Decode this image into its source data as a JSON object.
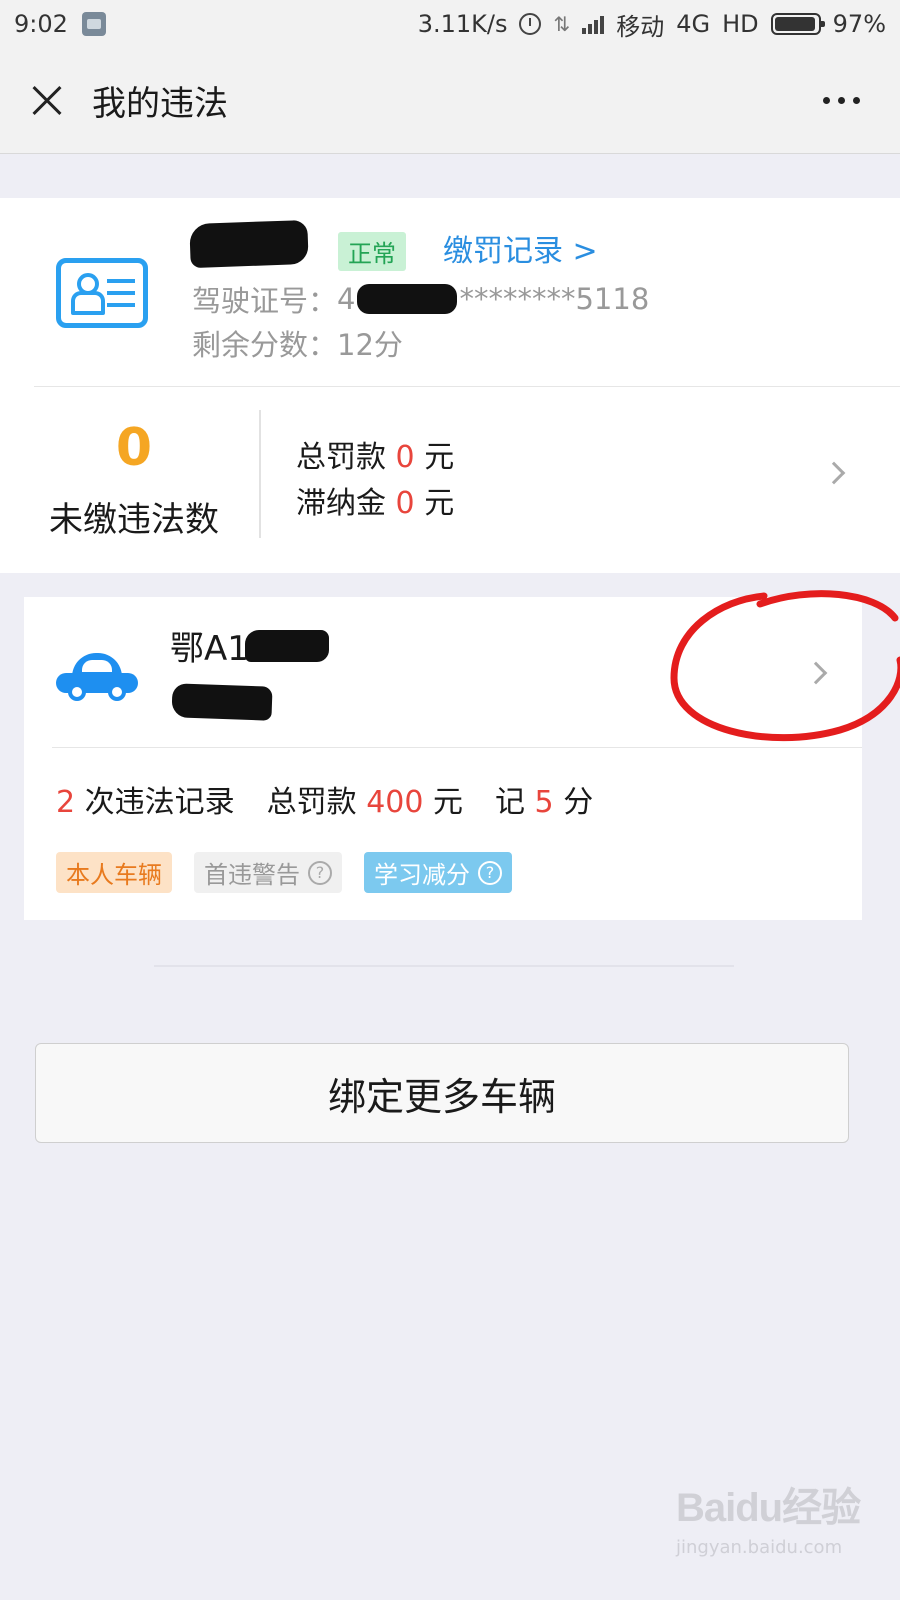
{
  "status_bar": {
    "time": "9:02",
    "net_speed": "3.11K/s",
    "carrier": "移动",
    "network": "4G",
    "hd": "HD",
    "battery": "97%"
  },
  "nav": {
    "title": "我的违法"
  },
  "license": {
    "status_tag": "正常",
    "pay_record_link": "缴罚记录 >",
    "license_no_label": "驾驶证号：",
    "license_no_prefix": "4",
    "license_no_suffix": "********5118",
    "points_left": "剩余分数：12分",
    "unpaid_count": "0",
    "unpaid_label": "未缴违法数",
    "fine_total_label": "总罚款",
    "fine_total_value": "0",
    "late_fee_label": "滞纳金",
    "late_fee_value": "0",
    "currency_unit": "元"
  },
  "vehicle": {
    "plate_prefix": "鄂A1",
    "record_count": "2",
    "record_label": "次违法记录",
    "fine_label": "总罚款",
    "fine_value": "400",
    "fine_unit": "元",
    "points_label": "记",
    "points_value": "5",
    "points_unit": "分",
    "tags": {
      "own_vehicle": "本人车辆",
      "first_offense_warning": "首违警告",
      "study_reduce_points": "学习减分",
      "help_glyph": "?"
    }
  },
  "bind_more_button": "绑定更多车辆",
  "watermark": {
    "logo": "Baidu经验",
    "url": "jingyan.baidu.com"
  },
  "colors": {
    "accent_blue": "#2a8ee0",
    "warning_orange": "#f5a623",
    "alert_red": "#e8453c",
    "status_green": "#23a455",
    "annotation_red": "#e41d1d"
  }
}
